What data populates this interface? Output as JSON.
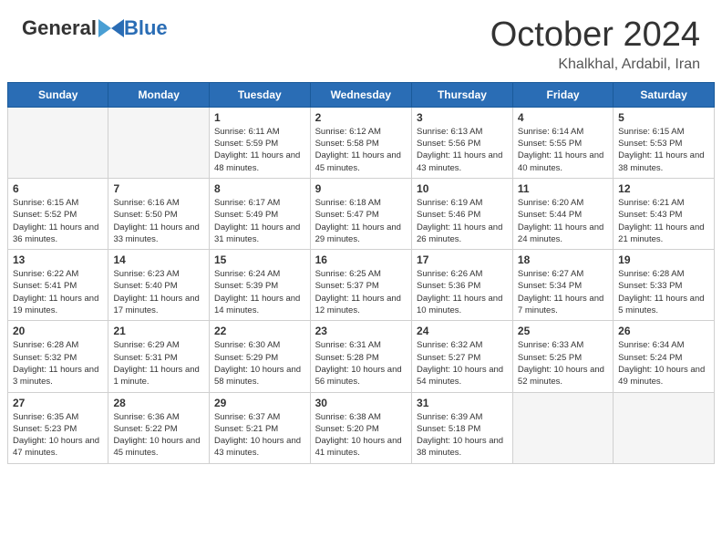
{
  "header": {
    "logo_general": "General",
    "logo_blue": "Blue",
    "month_title": "October 2024",
    "location": "Khalkhal, Ardabil, Iran"
  },
  "days_of_week": [
    "Sunday",
    "Monday",
    "Tuesday",
    "Wednesday",
    "Thursday",
    "Friday",
    "Saturday"
  ],
  "weeks": [
    [
      {
        "day": "",
        "empty": true
      },
      {
        "day": "",
        "empty": true
      },
      {
        "day": "1",
        "sunrise": "6:11 AM",
        "sunset": "5:59 PM",
        "daylight": "11 hours and 48 minutes."
      },
      {
        "day": "2",
        "sunrise": "6:12 AM",
        "sunset": "5:58 PM",
        "daylight": "11 hours and 45 minutes."
      },
      {
        "day": "3",
        "sunrise": "6:13 AM",
        "sunset": "5:56 PM",
        "daylight": "11 hours and 43 minutes."
      },
      {
        "day": "4",
        "sunrise": "6:14 AM",
        "sunset": "5:55 PM",
        "daylight": "11 hours and 40 minutes."
      },
      {
        "day": "5",
        "sunrise": "6:15 AM",
        "sunset": "5:53 PM",
        "daylight": "11 hours and 38 minutes."
      }
    ],
    [
      {
        "day": "6",
        "sunrise": "6:15 AM",
        "sunset": "5:52 PM",
        "daylight": "11 hours and 36 minutes."
      },
      {
        "day": "7",
        "sunrise": "6:16 AM",
        "sunset": "5:50 PM",
        "daylight": "11 hours and 33 minutes."
      },
      {
        "day": "8",
        "sunrise": "6:17 AM",
        "sunset": "5:49 PM",
        "daylight": "11 hours and 31 minutes."
      },
      {
        "day": "9",
        "sunrise": "6:18 AM",
        "sunset": "5:47 PM",
        "daylight": "11 hours and 29 minutes."
      },
      {
        "day": "10",
        "sunrise": "6:19 AM",
        "sunset": "5:46 PM",
        "daylight": "11 hours and 26 minutes."
      },
      {
        "day": "11",
        "sunrise": "6:20 AM",
        "sunset": "5:44 PM",
        "daylight": "11 hours and 24 minutes."
      },
      {
        "day": "12",
        "sunrise": "6:21 AM",
        "sunset": "5:43 PM",
        "daylight": "11 hours and 21 minutes."
      }
    ],
    [
      {
        "day": "13",
        "sunrise": "6:22 AM",
        "sunset": "5:41 PM",
        "daylight": "11 hours and 19 minutes."
      },
      {
        "day": "14",
        "sunrise": "6:23 AM",
        "sunset": "5:40 PM",
        "daylight": "11 hours and 17 minutes."
      },
      {
        "day": "15",
        "sunrise": "6:24 AM",
        "sunset": "5:39 PM",
        "daylight": "11 hours and 14 minutes."
      },
      {
        "day": "16",
        "sunrise": "6:25 AM",
        "sunset": "5:37 PM",
        "daylight": "11 hours and 12 minutes."
      },
      {
        "day": "17",
        "sunrise": "6:26 AM",
        "sunset": "5:36 PM",
        "daylight": "11 hours and 10 minutes."
      },
      {
        "day": "18",
        "sunrise": "6:27 AM",
        "sunset": "5:34 PM",
        "daylight": "11 hours and 7 minutes."
      },
      {
        "day": "19",
        "sunrise": "6:28 AM",
        "sunset": "5:33 PM",
        "daylight": "11 hours and 5 minutes."
      }
    ],
    [
      {
        "day": "20",
        "sunrise": "6:28 AM",
        "sunset": "5:32 PM",
        "daylight": "11 hours and 3 minutes."
      },
      {
        "day": "21",
        "sunrise": "6:29 AM",
        "sunset": "5:31 PM",
        "daylight": "11 hours and 1 minute."
      },
      {
        "day": "22",
        "sunrise": "6:30 AM",
        "sunset": "5:29 PM",
        "daylight": "10 hours and 58 minutes."
      },
      {
        "day": "23",
        "sunrise": "6:31 AM",
        "sunset": "5:28 PM",
        "daylight": "10 hours and 56 minutes."
      },
      {
        "day": "24",
        "sunrise": "6:32 AM",
        "sunset": "5:27 PM",
        "daylight": "10 hours and 54 minutes."
      },
      {
        "day": "25",
        "sunrise": "6:33 AM",
        "sunset": "5:25 PM",
        "daylight": "10 hours and 52 minutes."
      },
      {
        "day": "26",
        "sunrise": "6:34 AM",
        "sunset": "5:24 PM",
        "daylight": "10 hours and 49 minutes."
      }
    ],
    [
      {
        "day": "27",
        "sunrise": "6:35 AM",
        "sunset": "5:23 PM",
        "daylight": "10 hours and 47 minutes."
      },
      {
        "day": "28",
        "sunrise": "6:36 AM",
        "sunset": "5:22 PM",
        "daylight": "10 hours and 45 minutes."
      },
      {
        "day": "29",
        "sunrise": "6:37 AM",
        "sunset": "5:21 PM",
        "daylight": "10 hours and 43 minutes."
      },
      {
        "day": "30",
        "sunrise": "6:38 AM",
        "sunset": "5:20 PM",
        "daylight": "10 hours and 41 minutes."
      },
      {
        "day": "31",
        "sunrise": "6:39 AM",
        "sunset": "5:18 PM",
        "daylight": "10 hours and 38 minutes."
      },
      {
        "day": "",
        "empty": true
      },
      {
        "day": "",
        "empty": true
      }
    ]
  ]
}
